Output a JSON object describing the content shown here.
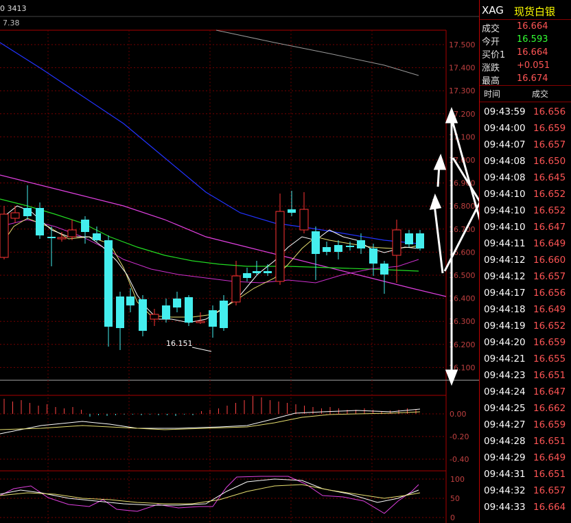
{
  "header": {
    "left_text": "0 3413",
    "sub_text": "7.38"
  },
  "price_axis": [
    "17.500",
    "17.400",
    "17.300",
    "17.200",
    "17.100",
    "17.000",
    "16.900",
    "16.800",
    "16.700",
    "16.600",
    "16.500",
    "16.400",
    "16.300",
    "16.200",
    "16.100"
  ],
  "macd_axis": [
    "0.00",
    "-0.20",
    "-0.40"
  ],
  "kdj_axis": [
    "100",
    "50",
    "0"
  ],
  "low_annotation": "16.151",
  "quote": {
    "symbol": "XAG",
    "name": "现货白银",
    "rows": [
      {
        "key": "成交",
        "value": "16.664",
        "color": "#ff5555"
      },
      {
        "key": "今开",
        "value": "16.593",
        "color": "#33ff33"
      },
      {
        "key": "买价1",
        "value": "16.664",
        "color": "#ff5555"
      },
      {
        "key": "涨跌",
        "value": "+0.051",
        "color": "#ff5555"
      },
      {
        "key": "最高",
        "value": "16.674",
        "color": "#ff5555"
      }
    ],
    "tick_header": {
      "time": "时间",
      "price": "成交"
    },
    "ticks": [
      {
        "time": "09:43:59",
        "price": "16.656"
      },
      {
        "time": "09:44:00",
        "price": "16.659"
      },
      {
        "time": "09:44:07",
        "price": "16.657"
      },
      {
        "time": "09:44:08",
        "price": "16.650"
      },
      {
        "time": "09:44:08",
        "price": "16.645"
      },
      {
        "time": "09:44:10",
        "price": "16.652"
      },
      {
        "time": "09:44:10",
        "price": "16.652"
      },
      {
        "time": "09:44:10",
        "price": "16.647"
      },
      {
        "time": "09:44:11",
        "price": "16.649"
      },
      {
        "time": "09:44:12",
        "price": "16.660"
      },
      {
        "time": "09:44:12",
        "price": "16.657"
      },
      {
        "time": "09:44:17",
        "price": "16.656"
      },
      {
        "time": "09:44:18",
        "price": "16.649"
      },
      {
        "time": "09:44:19",
        "price": "16.652"
      },
      {
        "time": "09:44:20",
        "price": "16.659"
      },
      {
        "time": "09:44:21",
        "price": "16.655"
      },
      {
        "time": "09:44:23",
        "price": "16.651"
      },
      {
        "time": "09:44:24",
        "price": "16.647"
      },
      {
        "time": "09:44:25",
        "price": "16.662"
      },
      {
        "time": "09:44:27",
        "price": "16.659"
      },
      {
        "time": "09:44:28",
        "price": "16.651"
      },
      {
        "time": "09:44:29",
        "price": "16.649"
      },
      {
        "time": "09:44:31",
        "price": "16.651"
      },
      {
        "time": "09:44:32",
        "price": "16.657"
      },
      {
        "time": "09:44:33",
        "price": "16.664"
      }
    ]
  }
}
